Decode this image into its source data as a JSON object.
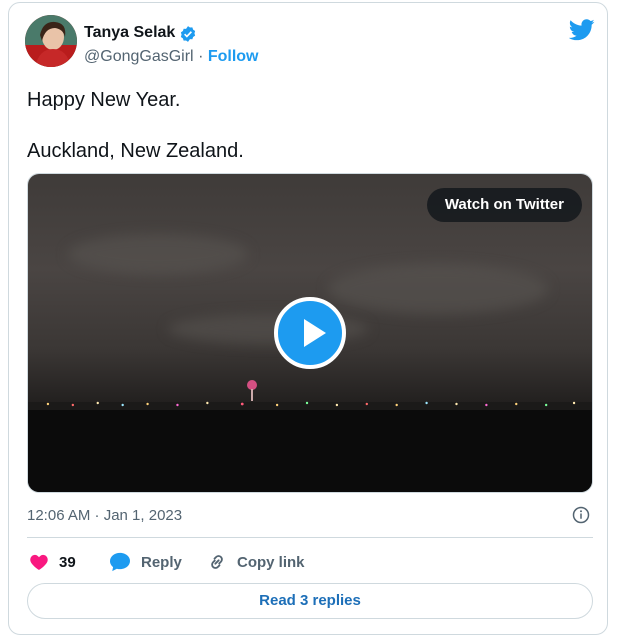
{
  "author": {
    "name": "Tanya Selak",
    "handle": "@GongGasGirl",
    "separator": "·",
    "follow_label": "Follow"
  },
  "tweet": {
    "line1": "Happy New Year.",
    "line2": "Auckland, New Zealand."
  },
  "media": {
    "watch_label": "Watch on Twitter",
    "play_icon": "play-icon"
  },
  "timestamp": "12:06 AM · Jan 1, 2023",
  "actions": {
    "likes_count": "39",
    "reply_label": "Reply",
    "copy_link_label": "Copy link"
  },
  "read_replies_label": "Read 3 replies",
  "colors": {
    "accent": "#1d9bf0",
    "like": "#f91880",
    "secondary_text": "#536471",
    "border": "#cfd9de"
  }
}
